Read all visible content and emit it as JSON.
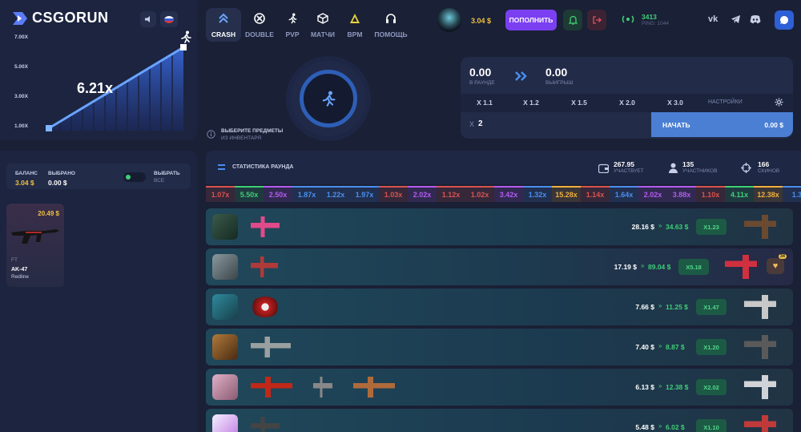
{
  "brand": {
    "logo_text": "CSGORUN"
  },
  "left_chart": {
    "multiplier": "6.21x",
    "y_ticks": [
      "7.00X",
      "5.00X",
      "3.00X",
      "1.00X"
    ]
  },
  "nav": [
    {
      "label": "CRASH",
      "icon": "chevrons-up-icon",
      "active": true
    },
    {
      "label": "DOUBLE",
      "icon": "double-icon"
    },
    {
      "label": "PVP",
      "icon": "running-man-icon"
    },
    {
      "label": "МАТЧИ",
      "icon": "cube-icon"
    },
    {
      "label": "BPM",
      "icon": "pyramid-icon"
    },
    {
      "label": "ПОМОЩЬ",
      "icon": "headphones-icon"
    }
  ],
  "user": {
    "balance": "3.04 $",
    "deposit_label": "ПОПОЛНИТЬ"
  },
  "online": {
    "count": "3413",
    "ping": "PING: 1044"
  },
  "game": {
    "hint_line1": "ВЫБЕРИТЕ ПРЕДМЕТЫ",
    "hint_line2": "ИЗ ИНВЕНТАРЯ",
    "in_round_value": "0.00",
    "in_round_label": "В РАУНДЕ",
    "win_value": "0.00",
    "win_label": "ВЫИГРЫШ",
    "presets": [
      "X 1.1",
      "X 1.2",
      "X 1.5",
      "X 2.0",
      "X 3.0"
    ],
    "settings_label": "НАСТРОЙКИ",
    "auto_prefix": "X",
    "auto_value": "2",
    "start_label": "НАЧАТЬ",
    "start_amount": "0.00 $"
  },
  "balance_panel": {
    "balance_label": "БАЛАНС",
    "balance_value": "3.04 $",
    "selected_label": "ВЫБРАНО",
    "selected_value": "0.00 $",
    "select_all_line1": "ВЫБРАТЬ",
    "select_all_line2": "ВСЕ"
  },
  "inventory": [
    {
      "price": "20.49 $",
      "quality": "FT",
      "name": "AK-47",
      "skin": "Redline"
    }
  ],
  "round_stats": {
    "title": "СТАТИСТИКА РАУНДА",
    "total": "267.95",
    "total_label": "УЧАСТВУЕТ",
    "players": "135",
    "players_label": "УЧАСТНИКОВ",
    "skins": "166",
    "skins_label": "СКИНОВ"
  },
  "history": [
    {
      "v": "1.07x",
      "c": "#d9534f"
    },
    {
      "v": "5.50x",
      "c": "#3ecf77"
    },
    {
      "v": "2.50x",
      "c": "#b25cf0"
    },
    {
      "v": "1.87x",
      "c": "#4a8ef0"
    },
    {
      "v": "1.22x",
      "c": "#4a8ef0"
    },
    {
      "v": "1.97x",
      "c": "#4a8ef0"
    },
    {
      "v": "1.03x",
      "c": "#d9534f"
    },
    {
      "v": "2.02x",
      "c": "#b25cf0"
    },
    {
      "v": "1.12x",
      "c": "#d9534f"
    },
    {
      "v": "1.02x",
      "c": "#d9534f"
    },
    {
      "v": "3.42x",
      "c": "#b25cf0"
    },
    {
      "v": "1.32x",
      "c": "#4a8ef0"
    },
    {
      "v": "15.28x",
      "c": "#f0b040"
    },
    {
      "v": "1.14x",
      "c": "#d9534f"
    },
    {
      "v": "1.64x",
      "c": "#4a8ef0"
    },
    {
      "v": "2.02x",
      "c": "#b25cf0"
    },
    {
      "v": "3.88x",
      "c": "#b25cf0"
    },
    {
      "v": "1.10x",
      "c": "#d9534f"
    },
    {
      "v": "4.11x",
      "c": "#3ecf77"
    },
    {
      "v": "12.38x",
      "c": "#f0b040"
    },
    {
      "v": "1.3",
      "c": "#4a8ef0"
    }
  ],
  "bets": [
    {
      "bet": "28.16 $",
      "win": "34.63 $",
      "coef": "X1.23"
    },
    {
      "bet": "17.19 $",
      "win": "89.04 $",
      "coef": "X5.18",
      "badge": "34"
    },
    {
      "bet": "7.66 $",
      "win": "11.25 $",
      "coef": "X1.47"
    },
    {
      "bet": "7.40 $",
      "win": "8.87 $",
      "coef": "X1.20"
    },
    {
      "bet": "6.13 $",
      "win": "12.38 $",
      "coef": "X2.02"
    },
    {
      "bet": "5.48 $",
      "win": "6.02 $",
      "coef": "X1.10"
    }
  ],
  "colors": {
    "accent": "#7b3ff2",
    "green": "#3ecf77",
    "start": "#4a7fd4"
  }
}
